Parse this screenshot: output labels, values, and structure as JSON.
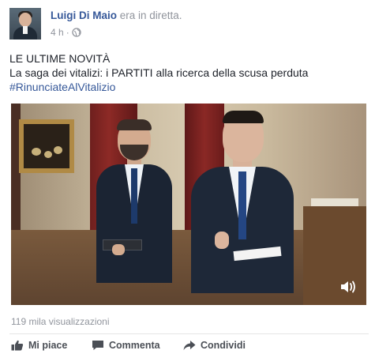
{
  "post": {
    "author": "Luigi Di Maio",
    "action": "era in diretta.",
    "time": "4 h",
    "separator": "·"
  },
  "text": {
    "line1": "LE ULTIME NOVITÀ",
    "line2": "La saga dei vitalizi: i PARTITI alla ricerca della scusa perduta",
    "hashtag": "#RinunciateAlVitalizio"
  },
  "video": {
    "views": "119 mila visualizzazioni",
    "volume_icon": "speaker-volume-icon"
  },
  "actions": {
    "like": "Mi piace",
    "comment": "Commenta",
    "share": "Condividi"
  },
  "colors": {
    "link": "#365899",
    "meta": "#90949c",
    "action_text": "#4b4f56"
  }
}
